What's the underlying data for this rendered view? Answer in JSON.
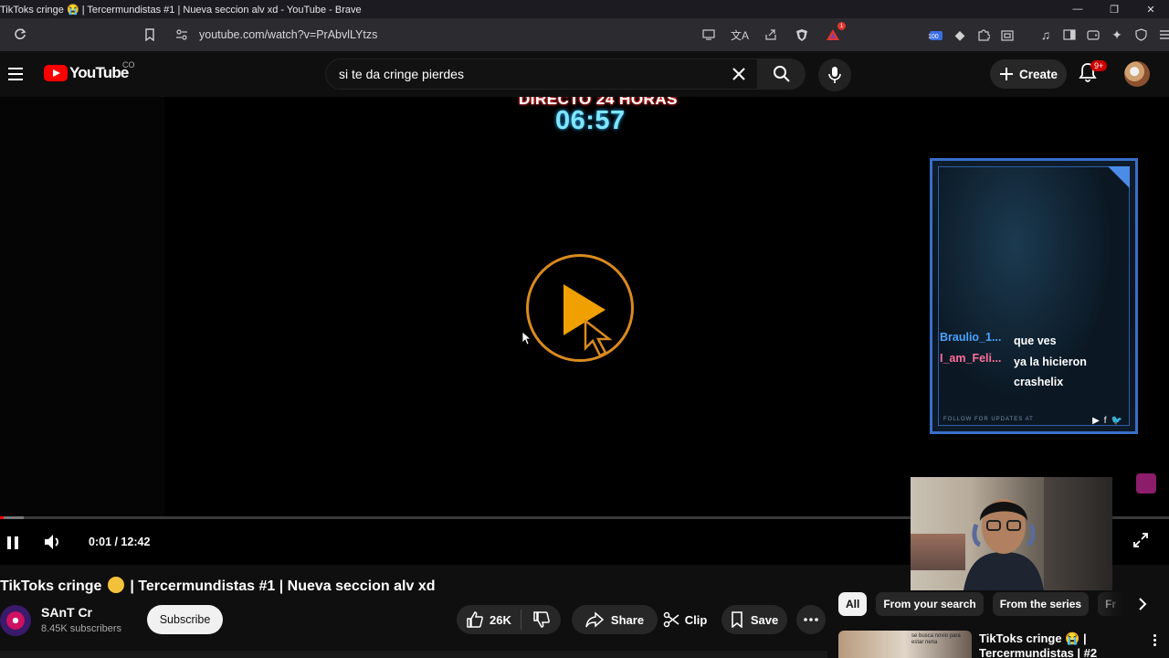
{
  "window": {
    "title": "TikToks cringe 😭 | Tercermundistas #1 | Nueva seccion alv xd - YouTube - Brave",
    "controls": [
      "—",
      "❐",
      "✕"
    ]
  },
  "browser": {
    "url": "youtube.com/watch?v=PrAbvlLYtzs",
    "extension_badge": "100"
  },
  "header": {
    "logo_text": "YouTube",
    "logo_country": "CO",
    "search_query": "si te da cringe pierdes",
    "create_label": "Create",
    "notification_count": "9+"
  },
  "player": {
    "overlay_title": "DIRECTO 24 HORAS",
    "overlay_clock": "06:57",
    "time": "0:01 / 12:42",
    "progress_fraction": 0.0013,
    "buffer_fraction": 0.02,
    "chat": {
      "messages": [
        {
          "user": "Braulio_1...",
          "text": "que ves",
          "color": "#4aa3ff"
        },
        {
          "user": "I_am_Feli...",
          "text": "ya la hicieron crashelix",
          "color": "#ff6f9a"
        }
      ],
      "footer": "FOLLOW FOR UPDATES AT"
    }
  },
  "video": {
    "title_part1": "TikToks cringe",
    "title_part2": "| Tercermundistas #1 | Nueva seccion alv xd",
    "channel": "SAnT Cr",
    "subscribers": "8.45K subscribers",
    "subscribe_label": "Subscribe",
    "likes": "26K",
    "share_label": "Share",
    "clip_label": "Clip",
    "save_label": "Save"
  },
  "sidebar": {
    "chips": [
      "All",
      "From your search",
      "From the series",
      "Fr"
    ],
    "rec": {
      "title_line1": "TikToks cringe 😭 |",
      "title_line2": "Tercermundistas | #2",
      "thumb_caption": "se busca novio para estar nena"
    }
  },
  "colors": {
    "accent": "#ff0000",
    "play_orange": "#f0a000",
    "chat_border": "#3a6ec8"
  }
}
